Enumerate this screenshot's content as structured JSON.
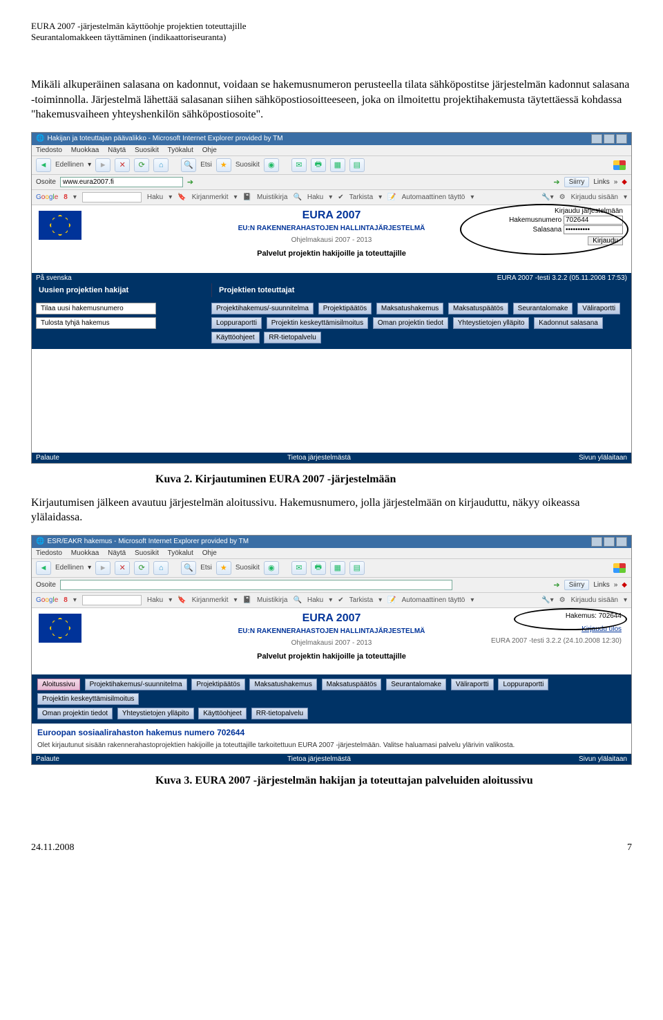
{
  "header": {
    "line1": "EURA 2007 -järjestelmän käyttöohje projektien toteuttajille",
    "line2": "Seurantalomakkeen täyttäminen (indikaattoriseuranta)"
  },
  "para1": "Mikäli alkuperäinen salasana on kadonnut, voidaan se hakemusnumeron perusteella tilata sähköpostitse järjestelmän kadonnut salasana -toiminnolla. Järjestelmä lähettää salasanan siihen sähköpostiosoitteeseen, joka on ilmoitettu projektihakemusta täytettäessä kohdassa \"hakemusvaiheen yhteyshenkilön sähköpostiosoite\".",
  "caption1": "Kuva 2. Kirjautuminen EURA 2007 -järjestelmään",
  "para2": "Kirjautumisen jälkeen avautuu järjestelmän aloitussivu. Hakemusnumero, jolla järjestelmään on kirjauduttu, näkyy oikeassa ylälaidassa.",
  "caption2": "Kuva 3. EURA 2007 -järjestelmän hakijan ja toteuttajan palveluiden aloitussivu",
  "footer": {
    "date": "24.11.2008",
    "page": "7"
  },
  "ie_menus": [
    "Tiedosto",
    "Muokkaa",
    "Näytä",
    "Suosikit",
    "Työkalut",
    "Ohje"
  ],
  "ie_toolbar": {
    "back": "Edellinen",
    "search": "Etsi",
    "fav": "Suosikit"
  },
  "address_label": "Osoite",
  "siirry": "Siirry",
  "links": "Links",
  "google_items": [
    "Haku",
    "Kirjanmerkit",
    "Muistikirja",
    "Haku",
    "Tarkista",
    "Automaattinen täyttö"
  ],
  "google_login": "Kirjaudu sisään",
  "shot1": {
    "title": "Hakijan ja toteuttajan päävalikko - Microsoft Internet Explorer provided by TM",
    "url": "www.eura2007.fi",
    "eura_title": "EURA 2007",
    "eura_sub": "EU:N RAKENNERAHASTOJEN HALLINTAJÄRJESTELMÄ",
    "eura_period": "Ohjelmakausi 2007 - 2013",
    "eura_services": "Palvelut projektin hakijoille ja toteuttajille",
    "login_head": "Kirjaudu järjestelmään",
    "login_num_label": "Hakemusnumero",
    "login_num_value": "702644",
    "login_pw_label": "Salasana",
    "login_pw_value": "••••••••••",
    "login_button": "Kirjaudu",
    "svensk": "På svenska",
    "version": "EURA 2007 -testi 3.2.2 (05.11.2008 17:53)",
    "left_head": "Uusien projektien hakijat",
    "right_head": "Projektien toteuttajat",
    "left_tabs": [
      "Tilaa uusi hakemusnumero",
      "Tulosta tyhjä hakemus"
    ],
    "right_tabs_row1": [
      "Projektihakemus/-suunnitelma",
      "Projektipäätös",
      "Maksatushakemus",
      "Maksatuspäätös",
      "Seurantalomake",
      "Väliraportti"
    ],
    "right_tabs_row2": [
      "Loppuraportti",
      "Projektin keskeyttämisilmoitus",
      "Oman projektin tiedot",
      "Yhteystietojen ylläpito",
      "Kadonnut salasana"
    ],
    "right_tabs_row3": [
      "Käyttöohjeet",
      "RR-tietopalvelu"
    ],
    "foot_left": "Palaute",
    "foot_mid": "Tietoa järjestelmästä",
    "foot_right": "Sivun ylälaitaan"
  },
  "shot2": {
    "title": "ESR/EAKR hakemus - Microsoft Internet Explorer provided by TM",
    "hakemus_label": "Hakemus: 702644",
    "logout": "Kirjaudu ulos",
    "version": "EURA 2007 -testi 3.2.2 (24.10.2008 12:30)",
    "tabs_row1": [
      "Aloitussivu",
      "Projektihakemus/-suunnitelma",
      "Projektipäätös",
      "Maksatushakemus",
      "Maksatuspäätös",
      "Seurantalomake",
      "Väliraportti",
      "Loppuraportti",
      "Projektin keskeyttämisilmoitus"
    ],
    "tabs_row2": [
      "Oman projektin tiedot",
      "Yhteystietojen ylläpito",
      "Käyttöohjeet",
      "RR-tietopalvelu"
    ],
    "page_head": "Euroopan sosiaalirahaston hakemus numero 702644",
    "page_text": "Olet kirjautunut sisään rakennerahastoprojektien hakijoille ja toteuttajille tarkoitettuun EURA 2007 -järjestelmään. Valitse haluamasi palvelu ylärivin valikosta.",
    "foot_left": "Palaute",
    "foot_mid": "Tietoa järjestelmästä",
    "foot_right": "Sivun ylälaitaan"
  }
}
